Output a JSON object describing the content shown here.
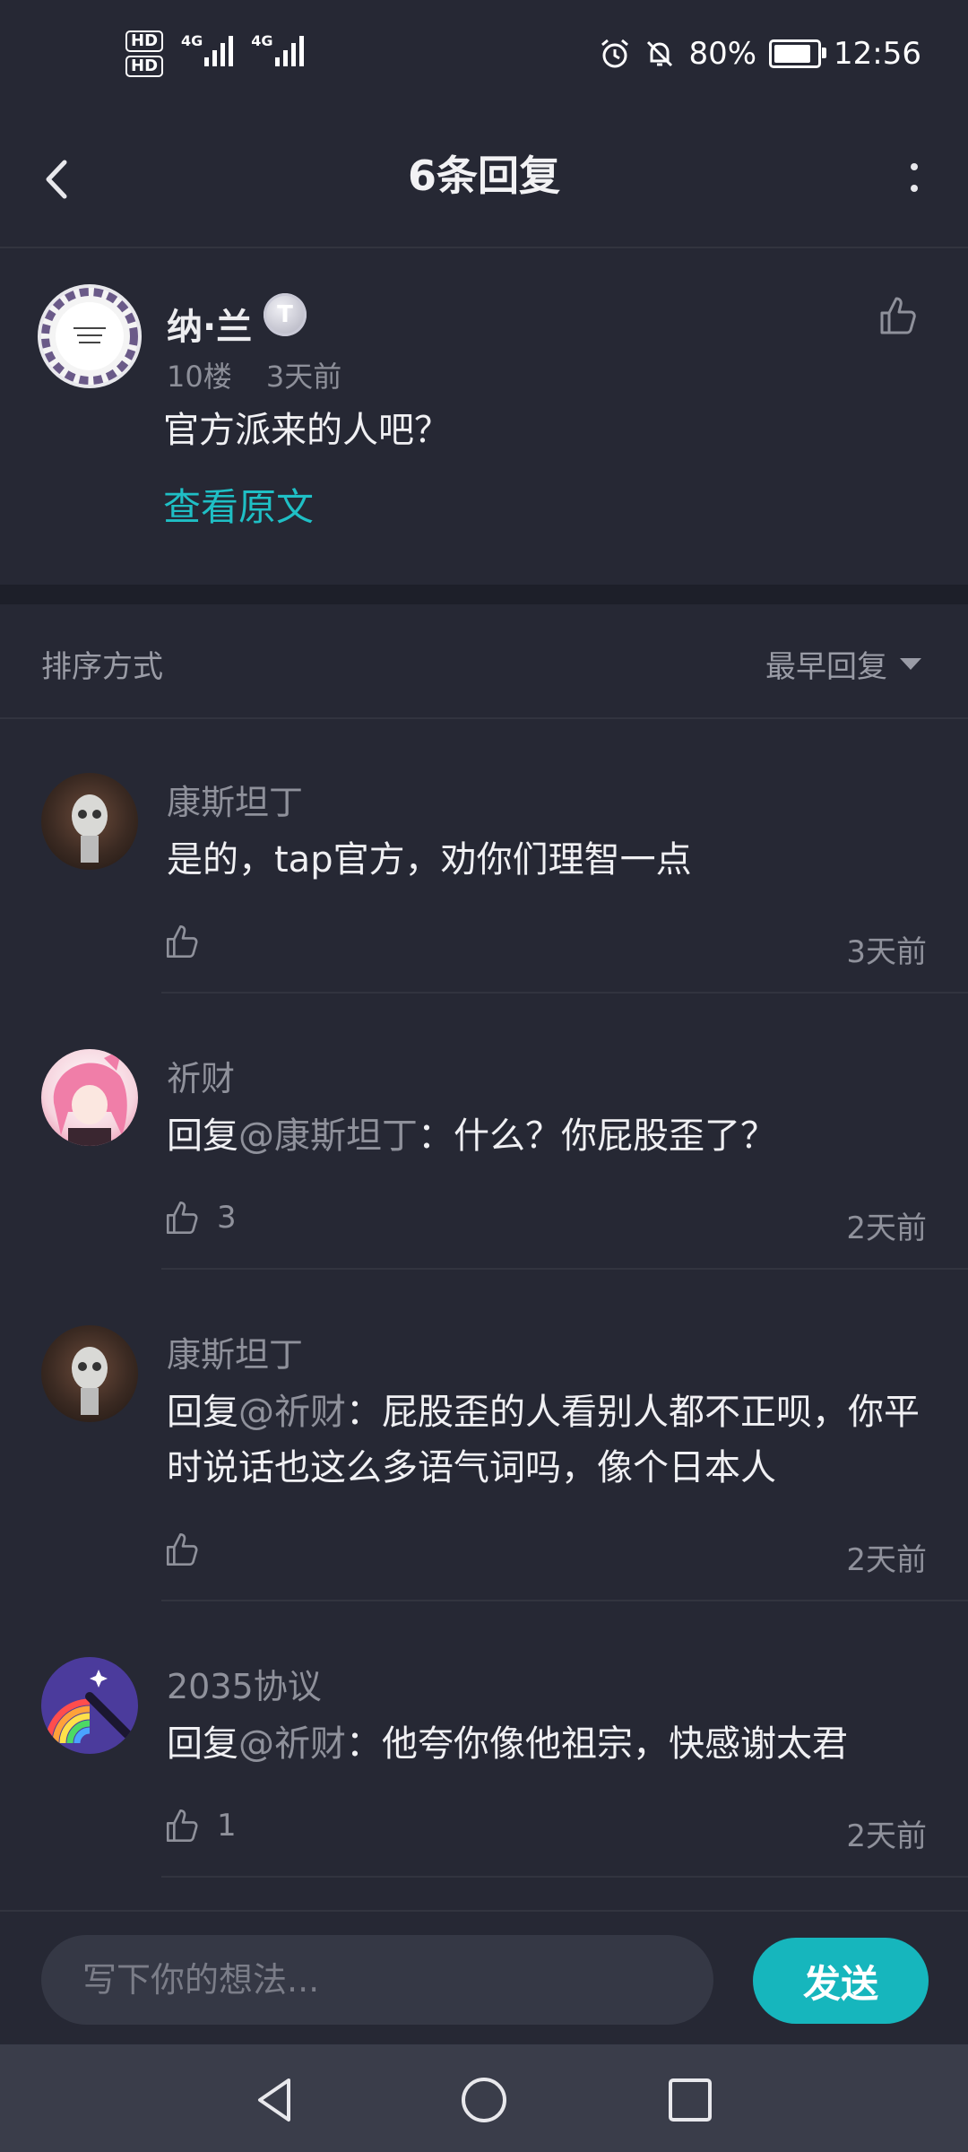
{
  "status_bar": {
    "hd1": "HD",
    "hd2": "HD",
    "net1": "4G",
    "net2": "4G",
    "battery_text": "80%",
    "battery_level": 0.8,
    "time": "12:56",
    "icons": [
      "alarm-icon",
      "mute-icon",
      "battery-icon"
    ]
  },
  "header": {
    "title": "6条回复",
    "back_icon": "back-chevron-icon",
    "more_icon": "more-vertical-icon"
  },
  "original_post": {
    "author": "纳·兰",
    "badge": "T",
    "floor": "10楼",
    "time": "3天前",
    "text": "官方派来的人吧？",
    "view_original": "查看原文"
  },
  "sort": {
    "label": "排序方式",
    "selected": "最早回复"
  },
  "replies": [
    {
      "name": "康斯坦丁",
      "prefix": "",
      "mention": "",
      "text": "是的，tap官方，劝你们理智一点",
      "likes": "",
      "time": "3天前"
    },
    {
      "name": "祈财",
      "prefix": "回复",
      "mention": "@康斯坦丁",
      "text": "：什么？你屁股歪了？",
      "likes": "3",
      "time": "2天前"
    },
    {
      "name": "康斯坦丁",
      "prefix": "回复",
      "mention": "@祈财",
      "text": "：屁股歪的人看别人都不正呗，你平时说话也这么多语气词吗，像个日本人",
      "likes": "",
      "time": "2天前"
    },
    {
      "name": "2035协议",
      "prefix": "回复",
      "mention": "@祈财",
      "text": "：他夸你像他祖宗，快感谢太君",
      "likes": "1",
      "time": "2天前"
    }
  ],
  "composer": {
    "placeholder": "写下你的想法...",
    "send_label": "发送"
  },
  "colors": {
    "background": "#262834",
    "accent": "#16b6bd",
    "link": "#1fbfc5"
  }
}
